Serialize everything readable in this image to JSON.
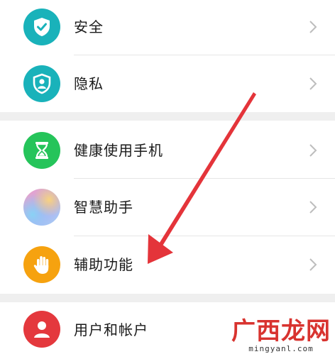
{
  "colors": {
    "security_icon_bg": "#19b2ba",
    "privacy_icon_bg": "#19b2ba",
    "health_icon_bg": "#25c45a",
    "assistant_icon_gradient": [
      "#f6a3c0",
      "#b9a3f2",
      "#89d2f5",
      "#f7d37f"
    ],
    "accessibility_icon_bg": "#f6a20f",
    "account_icon_bg": "#e4383d",
    "arrow": "#e4343a",
    "section_gap": "#efefef"
  },
  "settings": {
    "group1": [
      {
        "label": "安全",
        "icon": "shield-check-icon"
      },
      {
        "label": "隐私",
        "icon": "shield-person-icon"
      }
    ],
    "group2": [
      {
        "label": "健康使用手机",
        "icon": "hourglass-icon"
      },
      {
        "label": "智慧助手",
        "icon": "assistant-orb-icon"
      },
      {
        "label": "辅助功能",
        "icon": "hand-icon"
      }
    ],
    "group3": [
      {
        "label": "用户和帐户",
        "icon": "user-icon"
      }
    ]
  },
  "watermark": {
    "main": "广西龙网",
    "sub": "mingyanl.com"
  }
}
